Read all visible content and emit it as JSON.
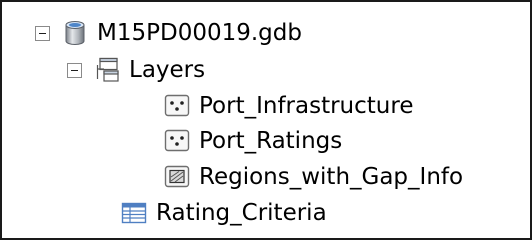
{
  "tree": {
    "database": {
      "label": "M15PD00019.gdb",
      "icon": "geodatabase-cylinder-icon",
      "expanded": true,
      "expander_icon": "collapse-minus-icon"
    },
    "layers_group": {
      "label": "Layers",
      "icon": "feature-dataset-icon",
      "expanded": true,
      "expander_icon": "collapse-minus-icon"
    },
    "layers": [
      {
        "label": "Port_Infrastructure",
        "icon": "point-feature-class-icon"
      },
      {
        "label": "Port_Ratings",
        "icon": "point-feature-class-icon"
      },
      {
        "label": "Regions_with_Gap_Info",
        "icon": "polygon-feature-class-icon"
      }
    ],
    "table": {
      "label": "Rating_Criteria",
      "icon": "table-icon"
    }
  },
  "colors": {
    "border": "#1a1a1a",
    "icon_blue": "#4f7fc2",
    "icon_gray": "#8c8c8c",
    "text": "#000000"
  }
}
